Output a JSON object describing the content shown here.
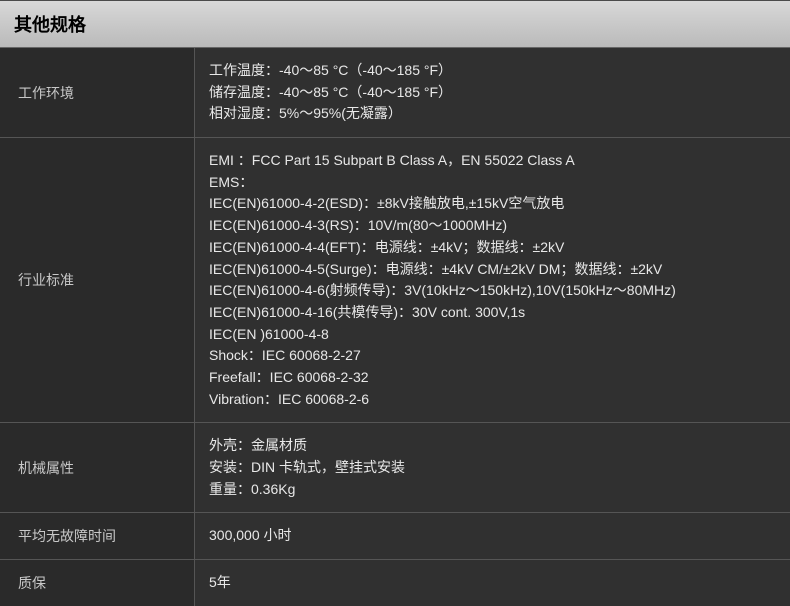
{
  "header": "其他规格",
  "rows": [
    {
      "label": "工作环境",
      "lines": [
        "工作温度：-40～85 °C（-40～185 °F）",
        "储存温度：-40～85 °C（-40～185 °F）",
        "相对湿度：5%～95%(无凝露）"
      ]
    },
    {
      "label": "行业标准",
      "lines": [
        "EMI ：FCC Part 15 Subpart B Class A，EN 55022 Class A",
        "EMS：",
        "IEC(EN)61000-4-2(ESD)：±8kV接触放电,±15kV空气放电",
        "IEC(EN)61000-4-3(RS)：10V/m(80～1000MHz)",
        "IEC(EN)61000-4-4(EFT)：电源线：±4kV；数据线：±2kV",
        "IEC(EN)61000-4-5(Surge)：电源线：±4kV CM/±2kV DM；数据线：±2kV",
        "IEC(EN)61000-4-6(射频传导)：3V(10kHz～150kHz),10V(150kHz～80MHz)",
        "IEC(EN)61000-4-16(共模传导)：30V cont. 300V,1s",
        "IEC(EN )61000-4-8",
        "Shock：IEC 60068-2-27",
        "Freefall：IEC 60068-2-32",
        "Vibration：IEC 60068-2-6"
      ]
    },
    {
      "label": "机械属性",
      "lines": [
        "外壳：金属材质",
        "安装：DIN 卡轨式，壁挂式安装",
        "重量：0.36Kg"
      ]
    },
    {
      "label": "平均无故障时间",
      "lines": [
        "300,000 小时"
      ]
    },
    {
      "label": "质保",
      "lines": [
        "5年"
      ]
    }
  ]
}
